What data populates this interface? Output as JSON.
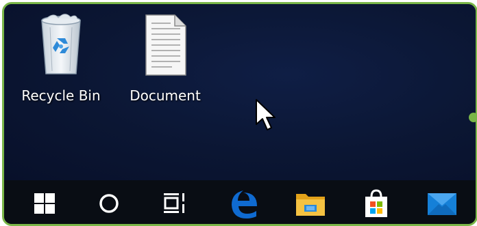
{
  "desktop": {
    "icons": [
      {
        "label": "Recycle Bin",
        "icon": "recycle-bin-icon"
      },
      {
        "label": "Document",
        "icon": "document-icon"
      }
    ]
  },
  "taskbar": {
    "items": [
      {
        "icon": "windows-start-icon"
      },
      {
        "icon": "cortana-search-icon"
      },
      {
        "icon": "task-view-icon"
      },
      {
        "icon": "edge-browser-icon"
      },
      {
        "icon": "file-explorer-icon"
      },
      {
        "icon": "microsoft-store-icon"
      },
      {
        "icon": "mail-icon"
      }
    ]
  },
  "colors": {
    "frame_border": "#7ab648",
    "desktop_background": "#0c1633",
    "taskbar_background": "#090d14",
    "edge_blue": "#0f6ad0",
    "explorer_yellow": "#f5c242",
    "mail_blue": "#1580d8"
  }
}
